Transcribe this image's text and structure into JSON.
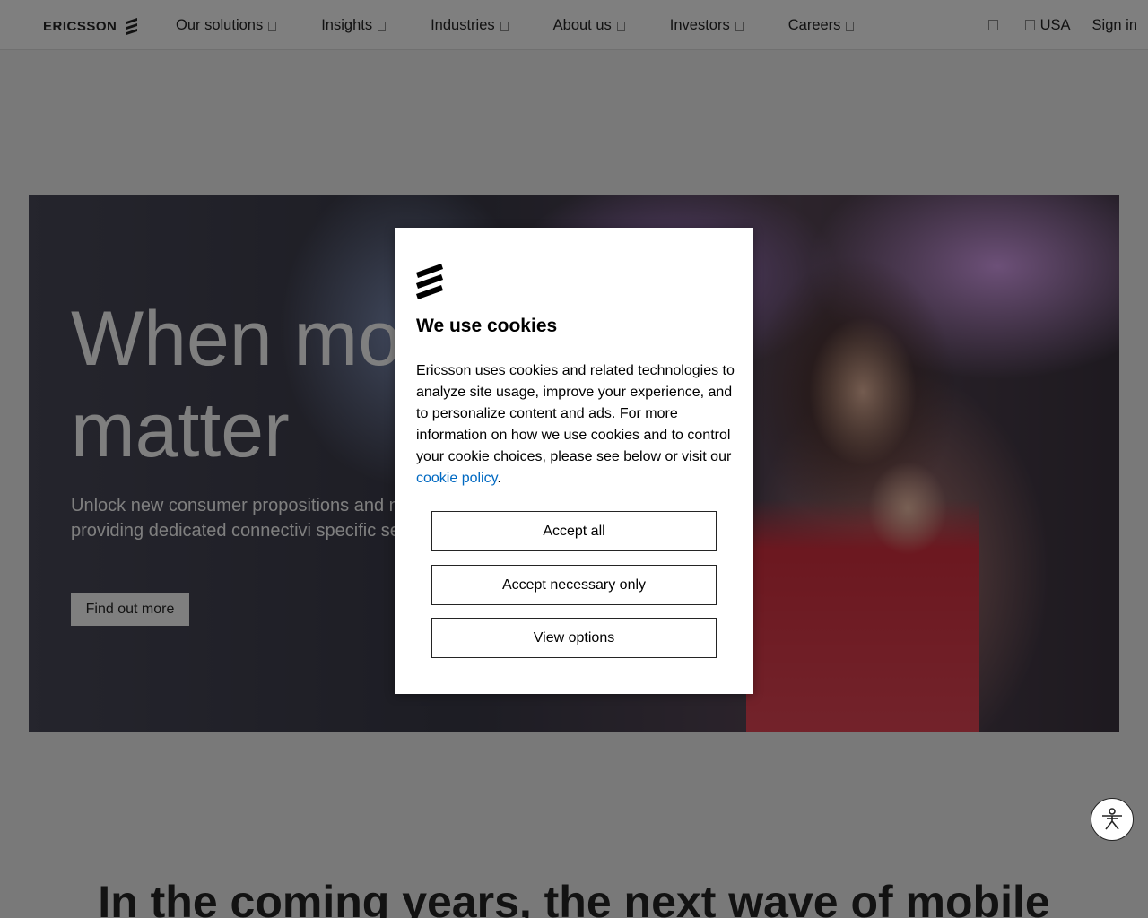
{
  "brand": {
    "wordmark": "ERICSSON"
  },
  "nav": {
    "items": [
      {
        "label": "Our solutions"
      },
      {
        "label": "Insights"
      },
      {
        "label": "Industries"
      },
      {
        "label": "About us"
      },
      {
        "label": "Investors"
      },
      {
        "label": "Careers"
      }
    ],
    "region_label": "USA",
    "signin_label": "Sign in"
  },
  "hero": {
    "title_line1": "When mo",
    "title_line2": "matter",
    "subtitle": "Unlock new consumer propositions and n streams by providing dedicated connectivi specific services",
    "cta_label": "Find out more"
  },
  "next_section": {
    "heading": "In the coming years, the next wave of mobile"
  },
  "cookie_modal": {
    "title": "We use cookies",
    "body_text": "Ericsson uses cookies and related technologies to analyze site usage, improve your experience, and to personalize content and ads. For more information on how we use cookies and to control your cookie choices, please see below or visit our ",
    "link_label": "cookie policy",
    "body_end": ".",
    "accept_all_label": "Accept all",
    "accept_necessary_label": "Accept necessary only",
    "view_options_label": "View options"
  },
  "colors": {
    "overlay": "#000000",
    "link": "#0069c2",
    "text_dark": "#242424"
  }
}
